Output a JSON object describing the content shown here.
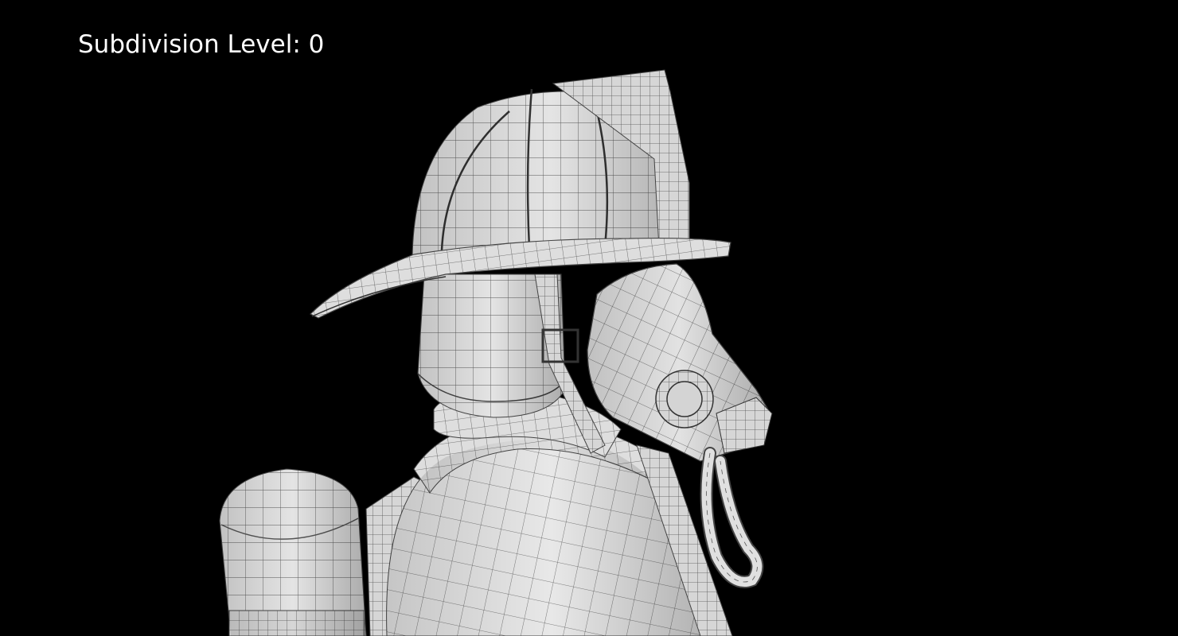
{
  "overlay": {
    "caption": "Subdivision Level: 0"
  },
  "colors": {
    "background": "#000000",
    "caption": "#ffffff",
    "surface": "#e6e6e6",
    "wire": "#5a5a5a"
  }
}
